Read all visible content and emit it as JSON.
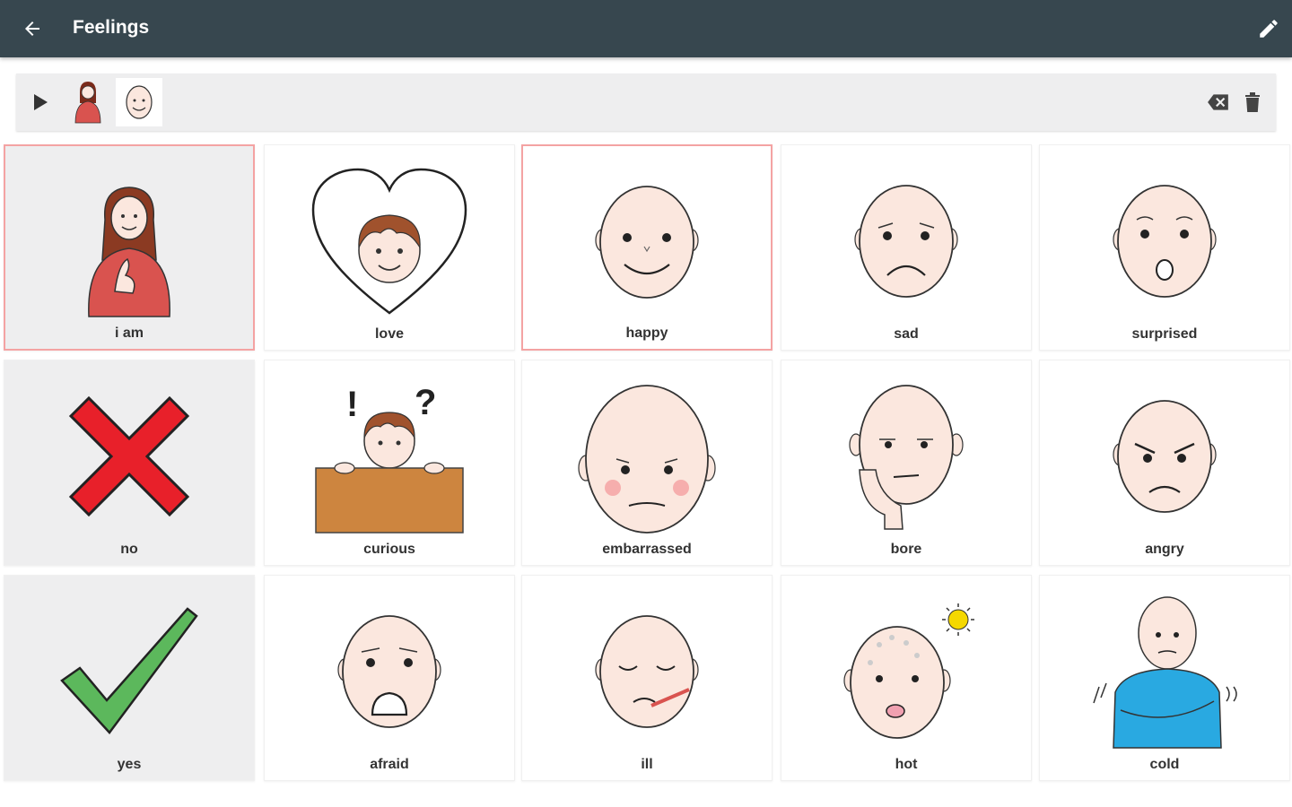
{
  "appbar": {
    "title": "Feelings"
  },
  "colors": {
    "appbar": "#37474f",
    "selected_border": "#f4a3a3",
    "sentence_bar": "#eeeeef"
  },
  "sentence": {
    "items": [
      "i am",
      "happy"
    ]
  },
  "tiles": [
    {
      "label": "i am",
      "icon": "person-self-icon"
    },
    {
      "label": "love",
      "icon": "heart-boy-icon"
    },
    {
      "label": "happy",
      "icon": "happy-face-icon"
    },
    {
      "label": "sad",
      "icon": "sad-face-icon"
    },
    {
      "label": "surprised",
      "icon": "surprised-face-icon"
    },
    {
      "label": "no",
      "icon": "red-cross-icon"
    },
    {
      "label": "curious",
      "icon": "curious-boy-icon"
    },
    {
      "label": "embarrassed",
      "icon": "embarrassed-face-icon"
    },
    {
      "label": "bore",
      "icon": "bored-face-icon"
    },
    {
      "label": "angry",
      "icon": "angry-face-icon"
    },
    {
      "label": "yes",
      "icon": "green-check-icon"
    },
    {
      "label": "afraid",
      "icon": "afraid-face-icon"
    },
    {
      "label": "ill",
      "icon": "ill-face-icon"
    },
    {
      "label": "hot",
      "icon": "hot-face-icon"
    },
    {
      "label": "cold",
      "icon": "cold-person-icon"
    }
  ]
}
